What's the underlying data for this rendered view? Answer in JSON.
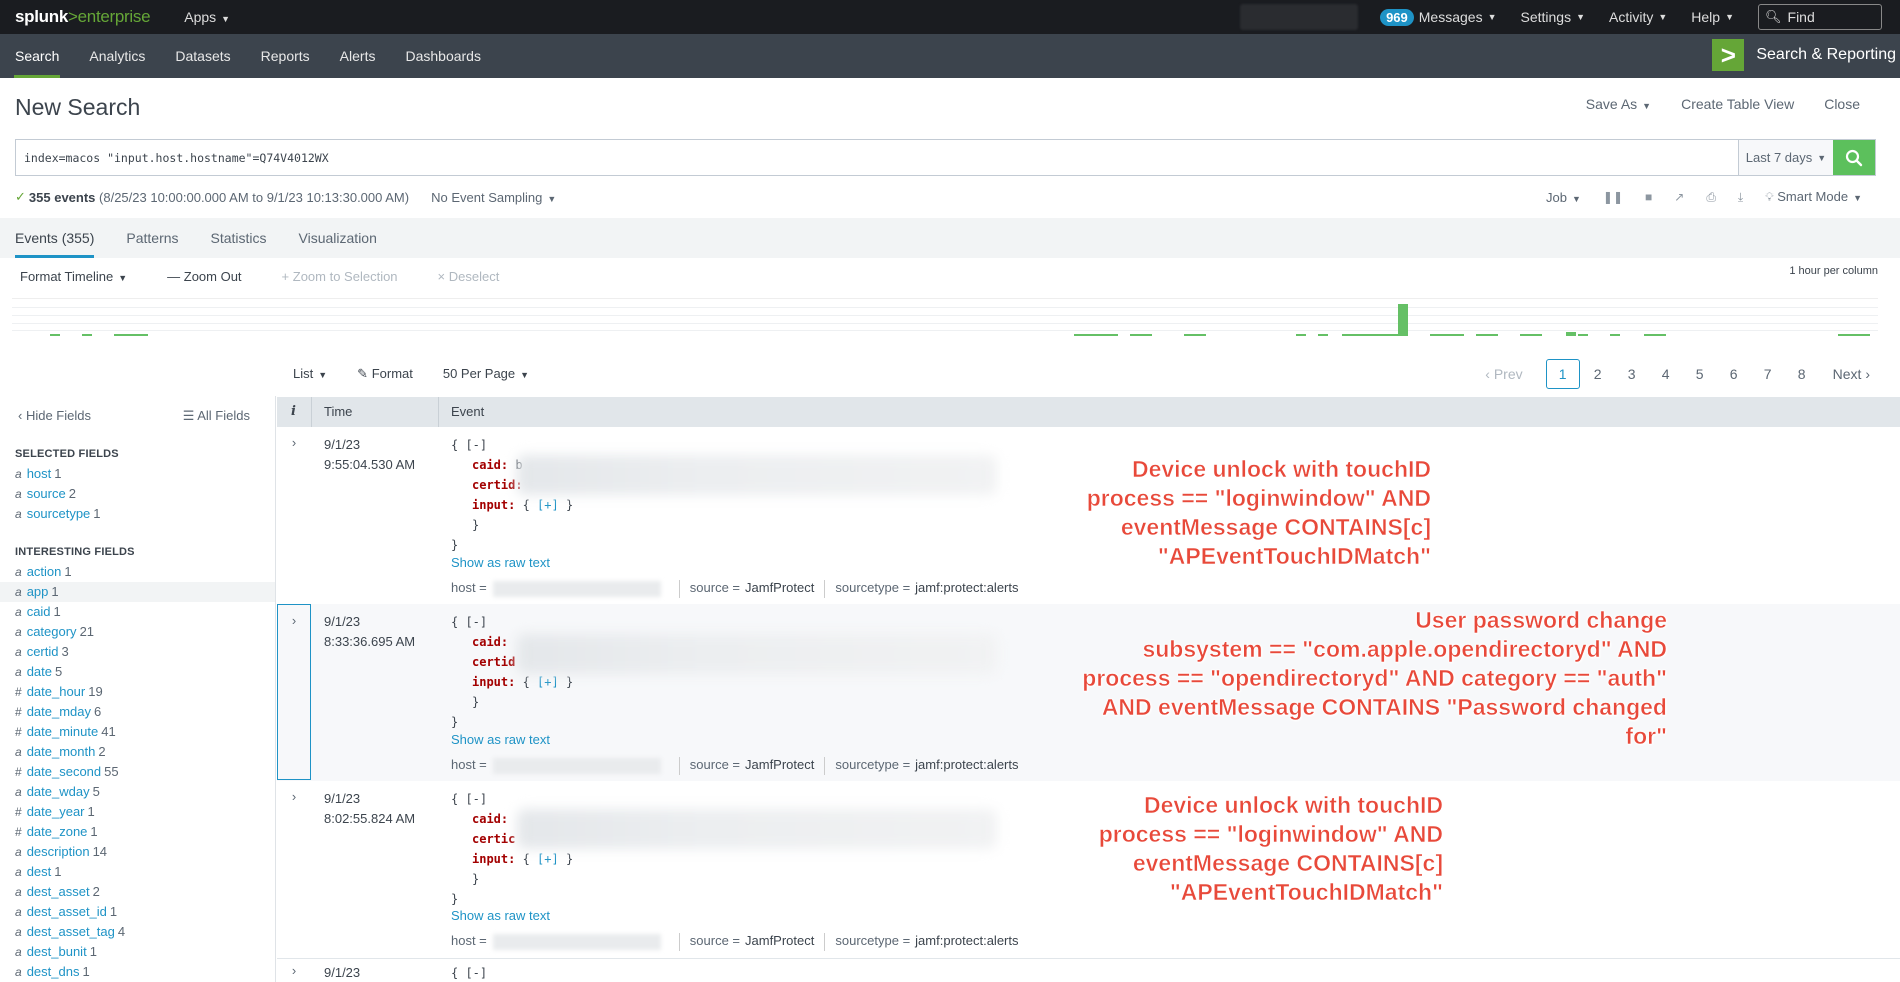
{
  "topbar": {
    "logo_main": "splunk",
    "logo_gt": ">",
    "logo_product": "enterprise",
    "apps": "Apps",
    "messages_count": "969",
    "messages": "Messages",
    "settings": "Settings",
    "activity": "Activity",
    "help": "Help",
    "find_placeholder": "Find"
  },
  "appbar": {
    "nav": [
      "Search",
      "Analytics",
      "Datasets",
      "Reports",
      "Alerts",
      "Dashboards"
    ],
    "app_name": "Search & Reporting"
  },
  "page": {
    "title": "New Search",
    "save_as": "Save As",
    "create_table_view": "Create Table View",
    "close": "Close"
  },
  "search": {
    "query": "index=macos  \"input.host.hostname\"=Q74V4012WX",
    "time_range": "Last 7 days"
  },
  "status": {
    "events_count": "355 events",
    "range": "(8/25/23 10:00:00.000 AM to 9/1/23 10:13:30.000 AM)",
    "sampling": "No Event Sampling",
    "job": "Job",
    "mode": "Smart Mode"
  },
  "tabs": [
    "Events (355)",
    "Patterns",
    "Statistics",
    "Visualization"
  ],
  "timeline": {
    "format": "Format Timeline",
    "zoom_out": "Zoom Out",
    "zoom_selection": "Zoom to Selection",
    "deselect": "Deselect",
    "per_column": "1 hour per column"
  },
  "results": {
    "list": "List",
    "format": "Format",
    "per_page": "50 Per Page",
    "prev": "Prev",
    "pages": [
      "1",
      "2",
      "3",
      "4",
      "5",
      "6",
      "7",
      "8"
    ],
    "next": "Next"
  },
  "sidebar": {
    "hide_fields": "Hide Fields",
    "all_fields": "All Fields",
    "selected_heading": "SELECTED FIELDS",
    "interesting_heading": "INTERESTING FIELDS",
    "selected": [
      {
        "type": "a",
        "name": "host",
        "count": "1"
      },
      {
        "type": "a",
        "name": "source",
        "count": "2"
      },
      {
        "type": "a",
        "name": "sourcetype",
        "count": "1"
      }
    ],
    "interesting": [
      {
        "type": "a",
        "name": "action",
        "count": "1"
      },
      {
        "type": "a",
        "name": "app",
        "count": "1"
      },
      {
        "type": "a",
        "name": "caid",
        "count": "1"
      },
      {
        "type": "a",
        "name": "category",
        "count": "21"
      },
      {
        "type": "a",
        "name": "certid",
        "count": "3"
      },
      {
        "type": "a",
        "name": "date",
        "count": "5"
      },
      {
        "type": "#",
        "name": "date_hour",
        "count": "19"
      },
      {
        "type": "#",
        "name": "date_mday",
        "count": "6"
      },
      {
        "type": "#",
        "name": "date_minute",
        "count": "41"
      },
      {
        "type": "a",
        "name": "date_month",
        "count": "2"
      },
      {
        "type": "#",
        "name": "date_second",
        "count": "55"
      },
      {
        "type": "a",
        "name": "date_wday",
        "count": "5"
      },
      {
        "type": "#",
        "name": "date_year",
        "count": "1"
      },
      {
        "type": "#",
        "name": "date_zone",
        "count": "1"
      },
      {
        "type": "a",
        "name": "description",
        "count": "14"
      },
      {
        "type": "a",
        "name": "dest",
        "count": "1"
      },
      {
        "type": "a",
        "name": "dest_asset",
        "count": "2"
      },
      {
        "type": "a",
        "name": "dest_asset_id",
        "count": "1"
      },
      {
        "type": "a",
        "name": "dest_asset_tag",
        "count": "4"
      },
      {
        "type": "a",
        "name": "dest_bunit",
        "count": "1"
      },
      {
        "type": "a",
        "name": "dest_dns",
        "count": "1"
      }
    ]
  },
  "events_table": {
    "col_i": "i",
    "col_time": "Time",
    "col_event": "Event"
  },
  "events": [
    {
      "date": "9/1/23",
      "time": "9:55:04.530 AM",
      "open": "{ [-]",
      "caid": "caid:",
      "caid_val": "b",
      "certid": "certid:",
      "input": "input:",
      "input_rest": " { ",
      "expand": "[+]",
      "close_brace": "}",
      "show_raw": "Show as raw text",
      "host_label": "host =",
      "source": "source =",
      "source_val": "JamfProtect",
      "sourcetype": "sourcetype =",
      "sourcetype_val": "jamf:protect:alerts"
    },
    {
      "date": "9/1/23",
      "time": "8:33:36.695 AM",
      "open": "{ [-]",
      "caid": "caid:",
      "caid_val": "",
      "certid": "certid",
      "input": "input:",
      "input_rest": " { ",
      "expand": "[+]",
      "close_brace": "}",
      "show_raw": "Show as raw text",
      "host_label": "host =",
      "source": "source =",
      "source_val": "JamfProtect",
      "sourcetype": "sourcetype =",
      "sourcetype_val": "jamf:protect:alerts"
    },
    {
      "date": "9/1/23",
      "time": "8:02:55.824 AM",
      "open": "{ [-]",
      "caid": "caid:",
      "caid_val": "",
      "certid": "certic",
      "input": "input:",
      "input_rest": " { ",
      "expand": "[+]",
      "close_brace": "}",
      "show_raw": "Show as raw text",
      "host_label": "host =",
      "source": "source =",
      "source_val": "JamfProtect",
      "sourcetype": "sourcetype =",
      "sourcetype_val": "jamf:protect:alerts"
    },
    {
      "date": "9/1/23",
      "open": "{ [-]"
    }
  ],
  "annotations": [
    {
      "lines": [
        "Device unlock with touchID",
        "process == \"loginwindow\" AND",
        "eventMessage CONTAINS[c]",
        "\"APEventTouchIDMatch\""
      ]
    },
    {
      "lines": [
        "User password change",
        "subsystem == \"com.apple.opendirectoryd\" AND",
        "process == \"opendirectoryd\" AND category == \"auth\"",
        "AND eventMessage CONTAINS \"Password changed",
        "for\""
      ]
    },
    {
      "lines": [
        "Device unlock with touchID",
        "process == \"loginwindow\" AND",
        "eventMessage CONTAINS[c]",
        "\"APEventTouchIDMatch\""
      ]
    }
  ],
  "colors": {
    "brand_green": "#65a637",
    "accent_blue": "#1e93c6",
    "annotation_red": "#e8493a"
  }
}
